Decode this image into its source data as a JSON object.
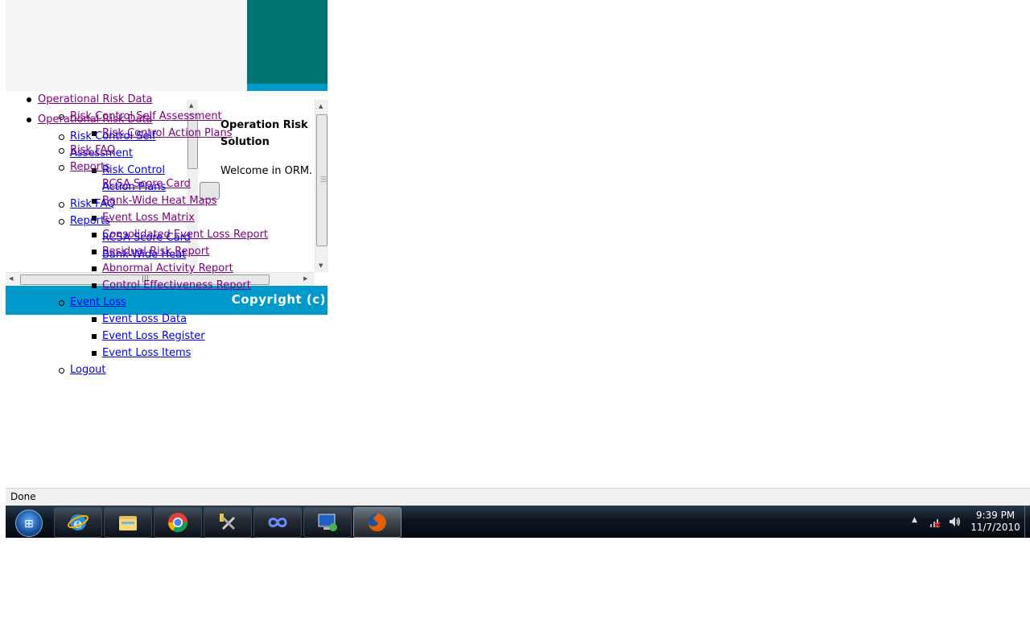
{
  "content": {
    "heading": "Operation Risk Solution",
    "welcome": "Welcome in ORM.",
    "copyright": "Copyright (c)"
  },
  "menu": {
    "operational_risk_data": "Operational Risk Data",
    "risk_control_self_assessment": "Risk Control Self Assessment",
    "risk_control_action_plans": "Risk Control Action Plans",
    "risk_faq": "Risk FAQ",
    "reports": "Reports",
    "rcsa_score_card": "RCSA Score Card",
    "bank_wide_heat_maps": "Bank-Wide Heat Maps",
    "event_loss_matrix": "Event Loss Matrix",
    "consolidated_event_loss_report": "Consolidated Event Loss Report",
    "residual_risk_report": "Residual Risk Report",
    "abnormal_activity_report": "Abnormal Activity Report",
    "control_effectiveness_report": "Control Effectiveness Report",
    "event_loss": "Event Loss",
    "event_loss_data": "Event Loss Data",
    "event_loss_register": "Event Loss Register",
    "event_loss_items": "Event Loss Items",
    "logout": "Logout",
    "wrap": {
      "risk_control_self": "Risk Control Self",
      "assessment": "Assessment",
      "risk_control": "Risk Control",
      "action_plans": "Action Plans",
      "bank_wide_heat": "Bank-Wide Heat"
    }
  },
  "browser": {
    "status": "Done"
  },
  "taskbar": {
    "time": "9:39 PM",
    "date": "11/7/2010",
    "apps": [
      "internet-explorer",
      "windows-explorer",
      "google-chrome",
      "tools",
      "infinity-app",
      "remote-desktop",
      "firefox"
    ]
  }
}
